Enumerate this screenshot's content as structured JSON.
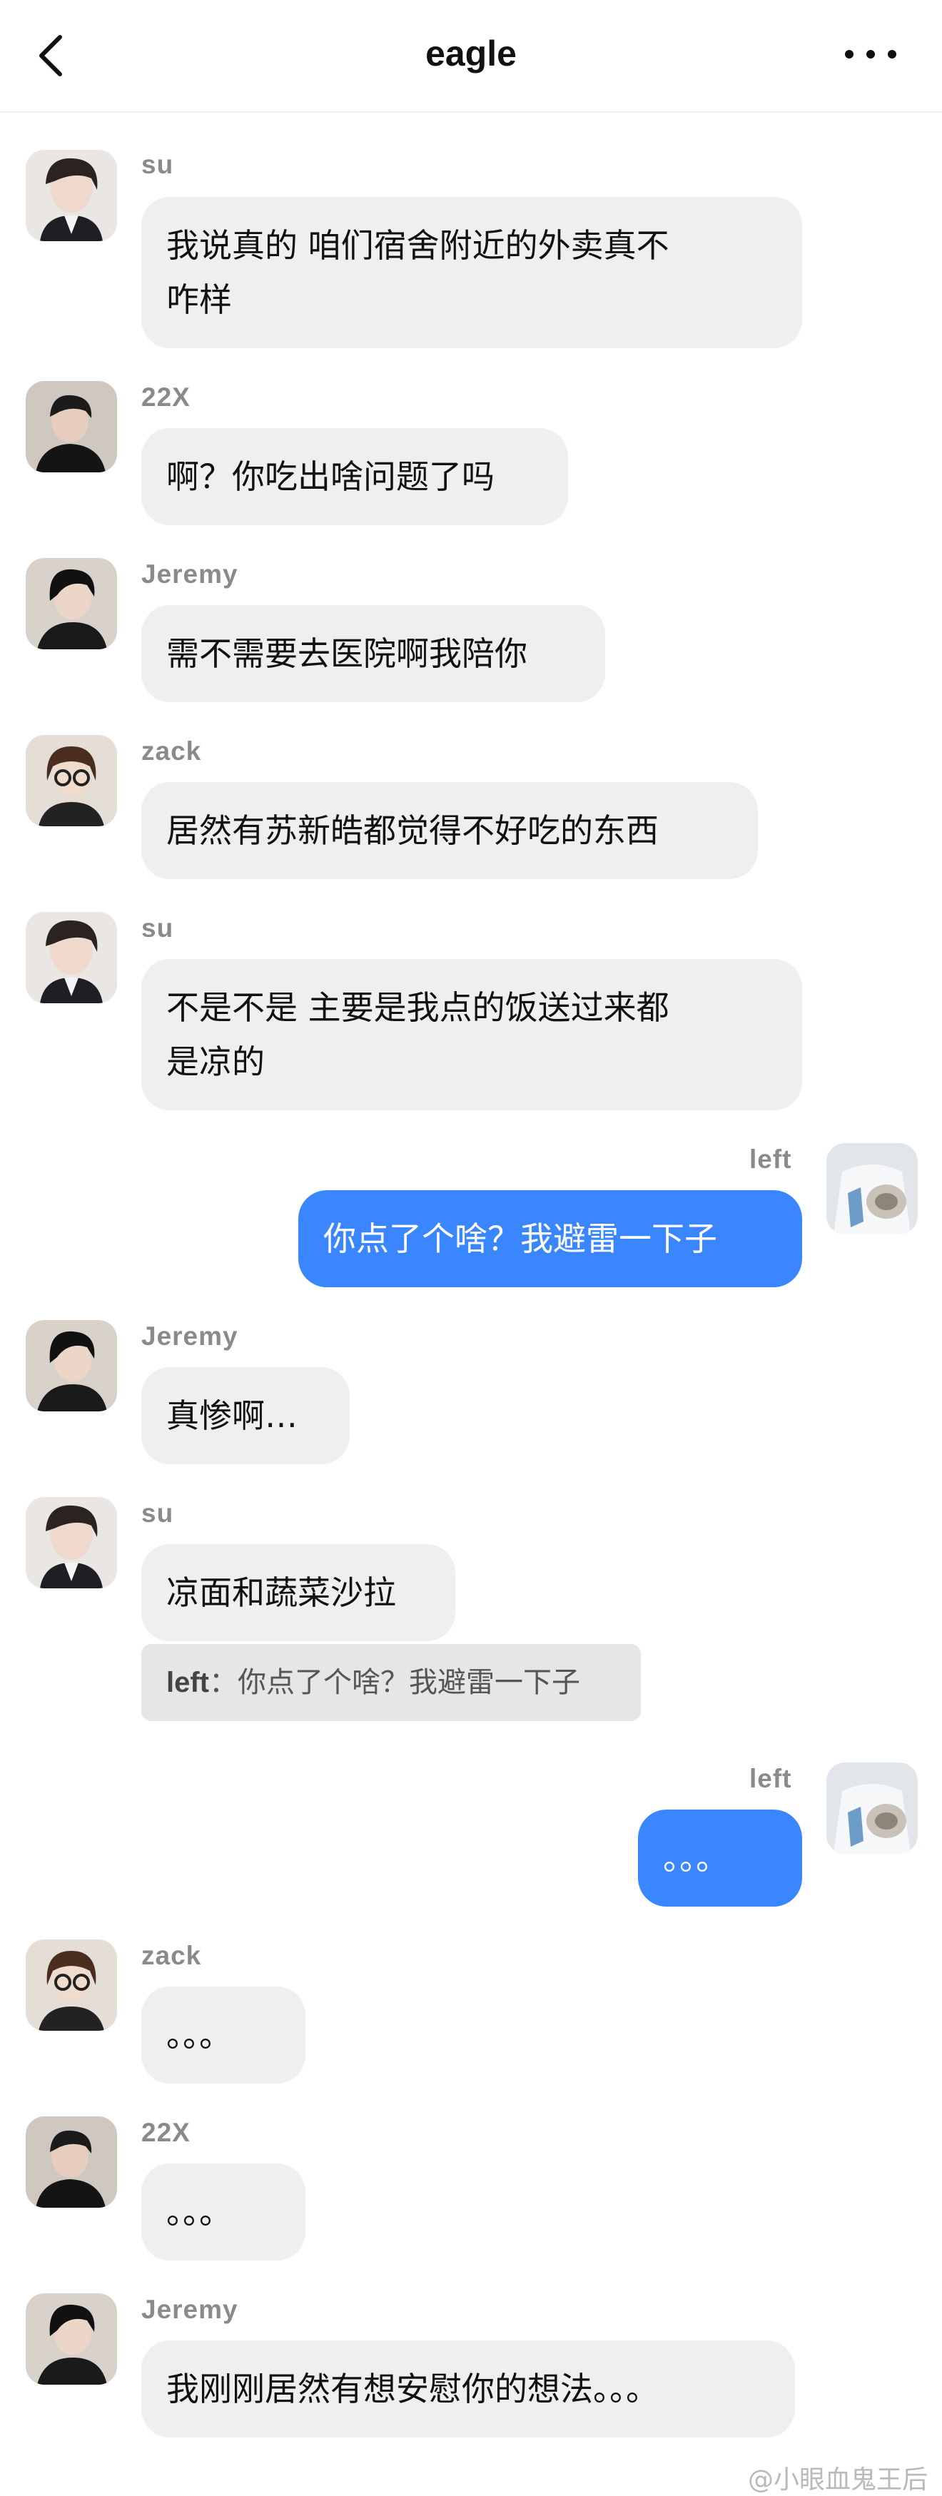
{
  "header": {
    "title": "eagle",
    "back_icon": "chevron-left-icon",
    "more_icon": "more-dots-icon"
  },
  "messages": [
    {
      "sender": "su",
      "text": "我说真的 咱们宿舍附近的外卖真不\n咋样",
      "mine": false,
      "avatar": "avatar-su"
    },
    {
      "sender": "22X",
      "text": "啊？你吃出啥问题了吗",
      "mine": false,
      "avatar": "avatar-22x"
    },
    {
      "sender": "Jeremy",
      "text": "需不需要去医院啊我陪你",
      "mine": false,
      "avatar": "avatar-jeremy"
    },
    {
      "sender": "zack",
      "text": "居然有苏新皓都觉得不好吃的东西",
      "mine": false,
      "avatar": "avatar-zack"
    },
    {
      "sender": "su",
      "text": "不是不是 主要是我点的饭送过来都\n是凉的",
      "mine": false,
      "avatar": "avatar-su"
    },
    {
      "sender": "left",
      "text": "你点了个啥？我避雷一下子",
      "mine": true,
      "avatar": "avatar-left"
    },
    {
      "sender": "Jeremy",
      "text": "真惨啊…",
      "mine": false,
      "avatar": "avatar-jeremy"
    },
    {
      "sender": "su",
      "text": "凉面和蔬菜沙拉",
      "mine": false,
      "avatar": "avatar-su",
      "quote": {
        "sender": "left",
        "text": "你点了个啥？我避雷一下子"
      }
    },
    {
      "sender": "left",
      "text": "。。。",
      "mine": true,
      "avatar": "avatar-left"
    },
    {
      "sender": "zack",
      "text": "。。。",
      "mine": false,
      "avatar": "avatar-zack"
    },
    {
      "sender": "22X",
      "text": "。。。",
      "mine": false,
      "avatar": "avatar-22x"
    },
    {
      "sender": "Jeremy",
      "text": "我刚刚居然有想安慰你的想法。。。",
      "mine": false,
      "avatar": "avatar-jeremy"
    }
  ],
  "watermark": "@小眼血鬼王后",
  "colors": {
    "accent": "#3a86ff",
    "bubble": "#efefef",
    "name": "#8a8a8a"
  }
}
